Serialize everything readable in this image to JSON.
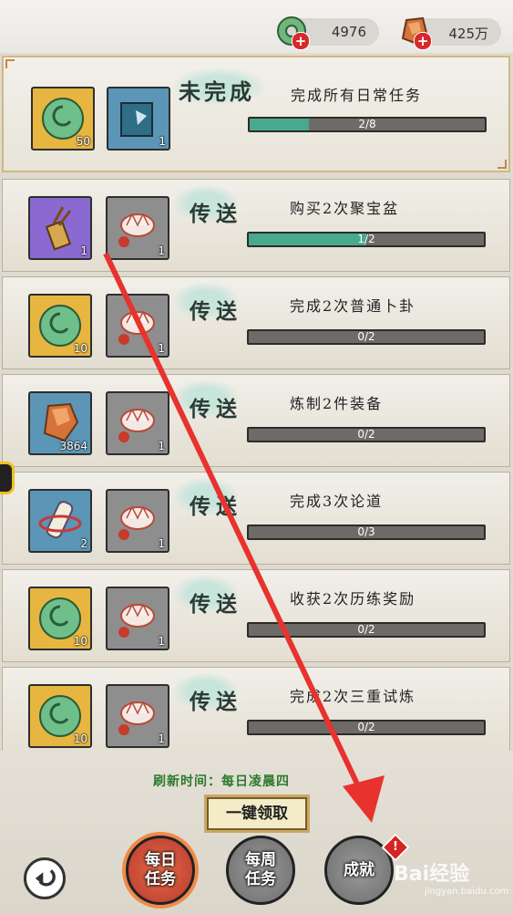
{
  "currencies": [
    {
      "icon": "jade-coin-icon",
      "value": "4976"
    },
    {
      "icon": "amber-crystal-icon",
      "value": "425万"
    }
  ],
  "summary": {
    "status": "未完成",
    "task": "完成所有日常任务",
    "progress_text": "2/8",
    "progress": 0.25,
    "rewards": [
      {
        "icon": "jade-coin-icon",
        "count": "50"
      },
      {
        "icon": "book-scroll-icon",
        "count": "1"
      }
    ]
  },
  "send_label": "传送",
  "tasks": [
    {
      "name": "购买2次聚宝盆",
      "progress_text": "1/2",
      "progress": 0.5,
      "rewards": [
        {
          "icon": "arrow-quiver-icon",
          "count": "1",
          "bg": "purple"
        },
        {
          "icon": "lotus-icon",
          "count": "1",
          "bg": "gray"
        }
      ]
    },
    {
      "name": "完成2次普通卜卦",
      "progress_text": "0/2",
      "progress": 0,
      "rewards": [
        {
          "icon": "jade-coin-icon",
          "count": "10",
          "bg": "gold"
        },
        {
          "icon": "lotus-icon",
          "count": "1",
          "bg": "gray"
        }
      ]
    },
    {
      "name": "炼制2件装备",
      "progress_text": "0/2",
      "progress": 0,
      "rewards": [
        {
          "icon": "amber-crystal-icon",
          "count": "3864",
          "bg": "blue"
        },
        {
          "icon": "lotus-icon",
          "count": "1",
          "bg": "gray"
        }
      ]
    },
    {
      "name": "完成3次论道",
      "progress_text": "0/3",
      "progress": 0,
      "rewards": [
        {
          "icon": "scroll-bottle-icon",
          "count": "2",
          "bg": "blue"
        },
        {
          "icon": "lotus-icon",
          "count": "1",
          "bg": "gray"
        }
      ]
    },
    {
      "name": "收获2次历练奖励",
      "progress_text": "0/2",
      "progress": 0,
      "rewards": [
        {
          "icon": "jade-coin-icon",
          "count": "10",
          "bg": "gold"
        },
        {
          "icon": "lotus-icon",
          "count": "1",
          "bg": "gray"
        }
      ]
    },
    {
      "name": "完成2次三重试炼",
      "progress_text": "0/2",
      "progress": 0,
      "rewards": [
        {
          "icon": "jade-coin-icon",
          "count": "10",
          "bg": "gold"
        },
        {
          "icon": "lotus-icon",
          "count": "1",
          "bg": "gray"
        }
      ]
    }
  ],
  "refresh_text": "刷新时间：每日凌晨四",
  "claim_all": "一键领取",
  "nav": {
    "daily": "每日\n任务",
    "weekly": "每周\n任务",
    "achievement": "成就",
    "badge": "!"
  },
  "watermark": {
    "brand": "Bai经验",
    "url": "jingyan.baidu.com"
  },
  "colors": {
    "progress_fill": "#4aa88c",
    "annotation_arrow": "#e8322e"
  }
}
